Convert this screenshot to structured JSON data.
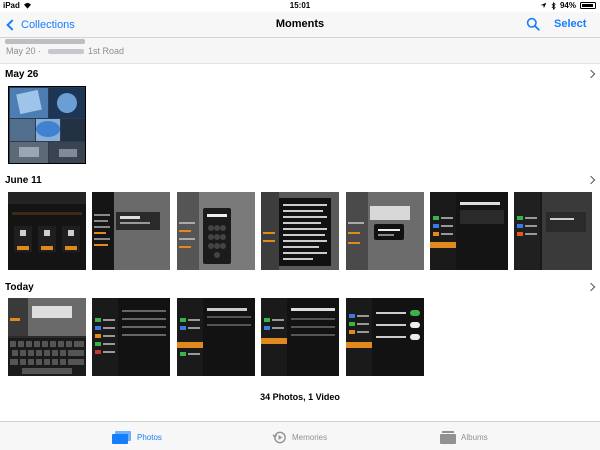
{
  "status": {
    "carrier": "iPad",
    "time": "15:01",
    "battery": "94%",
    "battery_fraction": 0.94
  },
  "nav": {
    "back_label": "Collections",
    "title": "Moments",
    "select_label": "Select"
  },
  "subheader": {
    "date": "May 20",
    "dot": "·",
    "place": "1st Road"
  },
  "sections": [
    {
      "title": "May 26"
    },
    {
      "title": "June 11"
    },
    {
      "title": "Today"
    }
  ],
  "summary": "34 Photos, 1 Video",
  "tabs": [
    {
      "label": "Photos"
    },
    {
      "label": "Memories"
    },
    {
      "label": "Albums"
    }
  ],
  "colors": {
    "accent": "#147efb",
    "inactive": "#929292",
    "orange": "#e0891c"
  }
}
